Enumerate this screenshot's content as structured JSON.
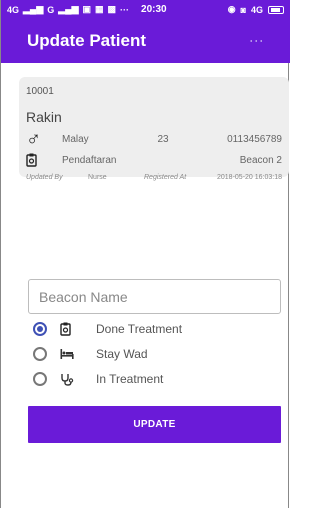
{
  "status_bar": {
    "network_left": "4G",
    "network_right": "G",
    "time": "20:30",
    "overflow": "···",
    "network_4g": "4G"
  },
  "app_bar": {
    "title": "Update Patient",
    "overflow_icon": "more-vert-icon"
  },
  "patient": {
    "id": "10001",
    "name": "Rakin",
    "gender_icon": "male-icon",
    "race": "Malay",
    "age": "23",
    "phone": "0113456789",
    "registration_icon": "clipboard-icon",
    "registration": "Pendaftaran",
    "beacon": "Beacon 2",
    "updated_by_label": "Updated By",
    "updated_by": "Nurse",
    "registered_at_label": "Registered At",
    "registered_at": "2018-05-20 16:03:18"
  },
  "form": {
    "beacon_placeholder": "Beacon Name",
    "beacon_value": "",
    "options": [
      {
        "label": "Done Treatment",
        "icon": "clipboard-icon",
        "checked": true
      },
      {
        "label": "Stay Wad",
        "icon": "bed-icon",
        "checked": false
      },
      {
        "label": "In Treatment",
        "icon": "stethoscope-icon",
        "checked": false
      }
    ],
    "update_label": "UPDATE"
  },
  "colors": {
    "primary": "#6a1bd8",
    "radio_accent": "#3f51b5",
    "card_bg": "#eeeeee"
  }
}
